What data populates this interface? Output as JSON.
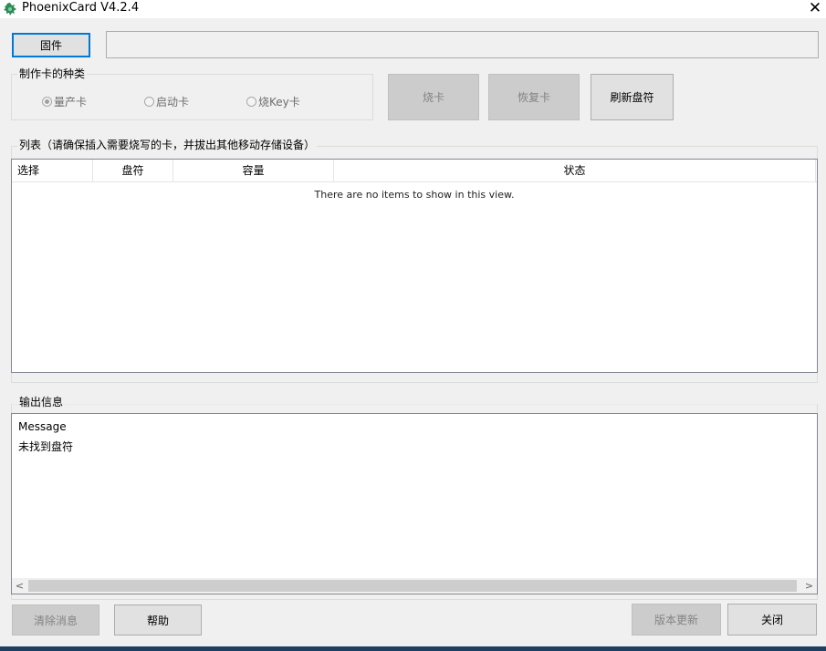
{
  "window": {
    "title": "PhoenixCard V4.2.4",
    "close_glyph": "✕"
  },
  "firmware": {
    "button_label": "固件",
    "path_value": ""
  },
  "card_type": {
    "legend": "制作卡的种类",
    "options": [
      {
        "label": "量产卡",
        "checked": true
      },
      {
        "label": "启动卡",
        "checked": false
      },
      {
        "label": "烧Key卡",
        "checked": false
      }
    ]
  },
  "actions": {
    "burn": "烧卡",
    "restore": "恢复卡",
    "refresh": "刷新盘符"
  },
  "device_list": {
    "legend": "列表（请确保插入需要烧写的卡，并拔出其他移动存储设备）",
    "columns": [
      "选择",
      "盘符",
      "容量",
      "状态"
    ],
    "empty_text": "There are no items to show in this view."
  },
  "output": {
    "legend": "输出信息",
    "lines": [
      "Message",
      "未找到盘符"
    ]
  },
  "footer": {
    "clear": "清除消息",
    "help": "帮助",
    "update": "版本更新",
    "close": "关闭"
  }
}
